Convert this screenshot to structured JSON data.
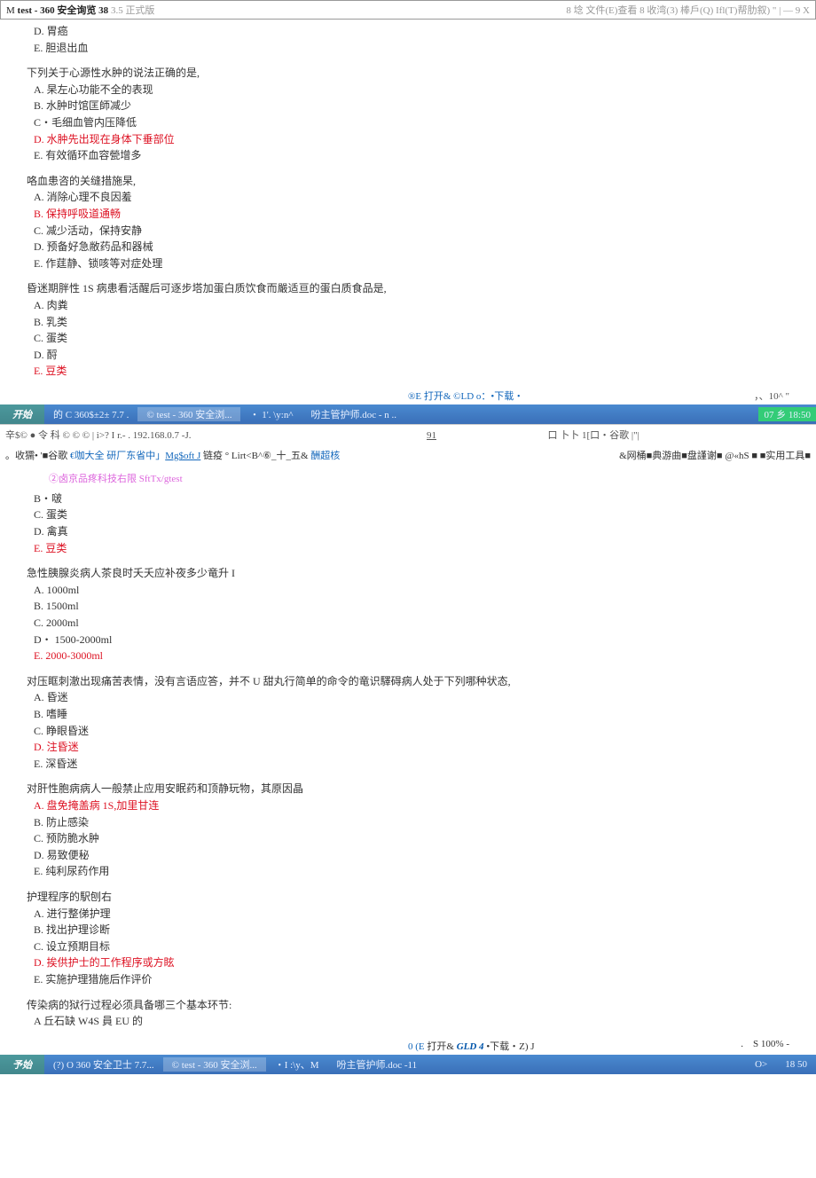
{
  "top_menubar": {
    "left_prefix": "M ",
    "title_bold": "test - 360 安全询览 38",
    "title_grey": " 3.5 正式版",
    "right": "8 埝 文件(E)查看 8 收湾(3) 棒戶(Q) Ifl(T)帮肋叙)          \" | — 9 X"
  },
  "block1": {
    "opts_pre": [
      "D.   胃癌",
      "E.   胆退出血"
    ],
    "q1": {
      "stem": "下列关于心源性水肿的说法正确的是,",
      "a": "A.   杲左心功能不全的表现",
      "b": "B.   水肿时馆匡師减少",
      "c": "C・毛细血管内压降低",
      "d": "D.   水肿先出现在身体下垂部位",
      "e": "E.   有效循环血容甇增多"
    },
    "q2": {
      "stem": "咯血患咨的关缝措施杲,",
      "a": "A.   消除心理不良因羞",
      "b": "B.   保持呼吸道通畅",
      "c": "C.   减少活动，保持安静",
      "d": "D.   预备好急敝药品和器械",
      "e": "E.   作莛静、锁咳等对症处理"
    },
    "q3": {
      "stem": "昏迷期胖性 1S 病患看活醒后可逐步塔加蛋白质饮食而嚴适亘的蛋白质食品是,",
      "a": "A.   肉粪",
      "b": "B.   乳类",
      "c": "C.   蛋类",
      "d": "D.   酹",
      "e": "E.   豆类"
    }
  },
  "status1": {
    "right": "®E 打开& ©LD o：•下载・",
    "far_right": "，、10^ \""
  },
  "taskbar1": {
    "start": "开始",
    "i1": "的 C 360$±2± 7.7 .",
    "i2": "© test - 360 安全浏...",
    "i3": "・ 1'. \\y:n^",
    "i4": "吩主管护师.doc - n ..",
    "clock1": "07 乡 18:50"
  },
  "addr1": "辛$© ● 令 科 © © © | i>? I r.- . 192.168.0.7 -J.",
  "addr1_mid": "91",
  "addr1_right": "口 卜卜 1[口・谷歌                |\"|",
  "linkline1": {
    "left_a": "。收獳• '■谷歌 ",
    "left_b": "€咖大全 研厂东省中」",
    "left_c": "Mg$oft J",
    "left_d": " 链疫 ",
    "left_e": "° Lirt<B^⑥_十_五& ",
    "left_f": "酬超核",
    "right": "&网桶■典游曲■盘謹谢■ @«hS ■ ■实用工具■"
  },
  "studio": "②卤京品疼科技右限 SftTx/gtest",
  "block2": {
    "opts_pre": [
      "B・啵",
      "C.   蛋类",
      "D.   禽真",
      "E.   豆类"
    ],
    "q4": {
      "stem": "急性胰腺炎病人茶良时夭夭应补夜多少竜升 I",
      "a": "A.   1000ml",
      "b": "B.   1500ml",
      "c": "C.   2000ml",
      "d": "D・ 1500-2000ml",
      "e": "E.   2000-3000ml"
    },
    "q5": {
      "stem": "对压眶刺澈出现痛苦表情，没有言语应答，并不 U 甜丸行简单的命令的竜识驛碍病人处于下列哪种状态,",
      "a": "A.   昏迷",
      "b": "B.   嗜睡",
      "c": "C.   睁眼昏迷",
      "d": "D.   注昏迷",
      "e": "E.   深昏迷"
    },
    "q6": {
      "stem": "对肝性胞病病人一般禁止应用安眠药和顶静玩物，其原因晶",
      "a": "A.   盘免掩盖病 1S,加里甘连",
      "b": "B.   防止感染",
      "c": "C.   预防脆水肿",
      "d": "D.   易致便秘",
      "e": "E.   纯利尿药作用"
    },
    "q7": {
      "stem": "护理程序的駅刨右",
      "a": "A.   进行整俤护理",
      "b": "B.   找出护理诊断",
      "c": "C.   设立预期目标",
      "d": "D.   挨供护士的工作程序或方眩",
      "e": "E.   实施护理猎施后作评价"
    },
    "q8": {
      "stem": "传染病的狱行过程必须具备哪三个基本环节:",
      "a": "A 丘石缺     W4S 員 EU 的"
    }
  },
  "status2": {
    "mid": "0 (E",
    "open": " 打开& ",
    "gld": "GLD 4",
    "rest": " •下载・Z) J",
    "zoom": "S 100% -"
  },
  "taskbar2": {
    "start": "予始",
    "i1": "(?) O 360 安全卫士 7.7...",
    "i2": "© test - 360 安全浏...",
    "i3": "・I :\\y、M",
    "i4": "吩主管护师.doc -11",
    "r1": "O>",
    "clock": "18 50"
  }
}
